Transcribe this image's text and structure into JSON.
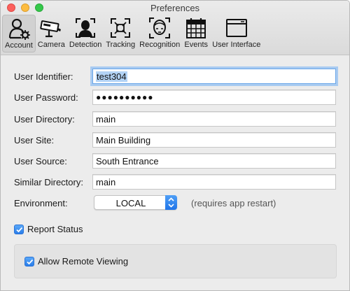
{
  "window": {
    "title": "Preferences"
  },
  "toolbar": {
    "items": [
      {
        "label": "Account",
        "icon": "account-icon",
        "active": true
      },
      {
        "label": "Camera",
        "icon": "camera-icon"
      },
      {
        "label": "Detection",
        "icon": "detection-icon"
      },
      {
        "label": "Tracking",
        "icon": "tracking-icon"
      },
      {
        "label": "Recognition",
        "icon": "recognition-icon"
      },
      {
        "label": "Events",
        "icon": "events-icon"
      },
      {
        "label": "User Interface",
        "icon": "user-interface-icon"
      }
    ]
  },
  "form": {
    "user_identifier": {
      "label": "User Identifier:",
      "value": "test304"
    },
    "user_password": {
      "label": "User Password:",
      "value": "●●●●●●●●●●"
    },
    "user_directory": {
      "label": "User Directory:",
      "value": "main"
    },
    "user_site": {
      "label": "User Site:",
      "value": "Main Building"
    },
    "user_source": {
      "label": "User Source:",
      "value": "South Entrance"
    },
    "similar_directory": {
      "label": "Similar Directory:",
      "value": "main"
    },
    "environment": {
      "label": "Environment:",
      "value": "LOCAL",
      "hint": "(requires app restart)"
    }
  },
  "checkboxes": {
    "report_status": {
      "label": "Report Status",
      "checked": true
    },
    "allow_remote_viewing": {
      "label": "Allow Remote Viewing",
      "checked": true
    }
  },
  "colors": {
    "accent": "#2a7de9",
    "focus_ring": "#a9cbf1"
  }
}
